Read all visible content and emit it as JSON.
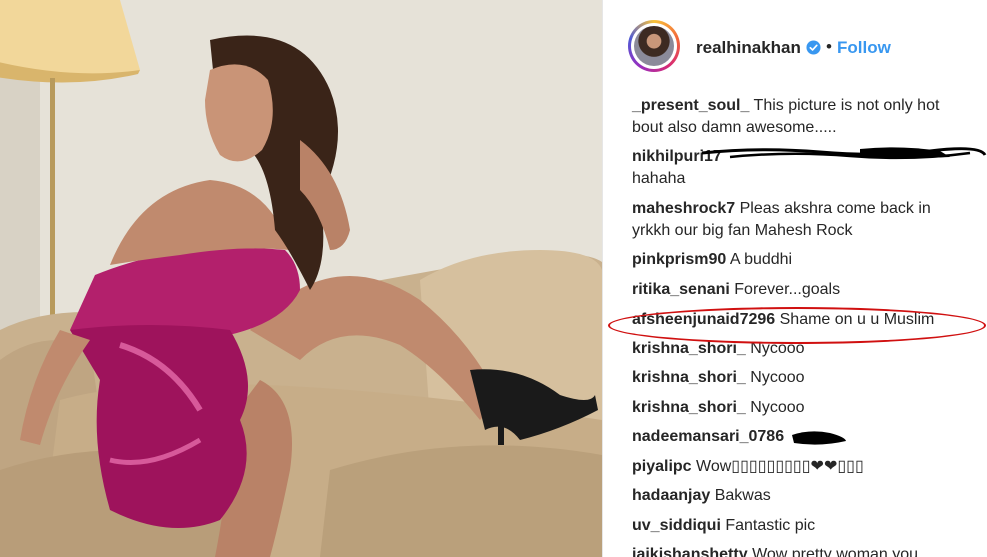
{
  "post": {
    "username": "realhinakhan",
    "follow_label": "Follow",
    "separator": "•"
  },
  "comments": [
    {
      "user": "_present_soul_",
      "text": "This picture is not only hot bout also damn awesome....."
    },
    {
      "user": "nikhilpuri17",
      "text": "hahaha"
    },
    {
      "user": "maheshrock7",
      "text": "Pleas akshra come back in yrkkh our big fan Mahesh Rock"
    },
    {
      "user": "pinkprism90",
      "text": "A buddhi"
    },
    {
      "user": "ritika_senani",
      "text": "Forever...goals"
    },
    {
      "user": "afsheenjunaid7296",
      "text": "Shame on u u Muslim"
    },
    {
      "user": "krishna_shori_",
      "text": "Nycooo"
    },
    {
      "user": "krishna_shori_",
      "text": "Nycooo"
    },
    {
      "user": "krishna_shori_",
      "text": "Nycooo"
    },
    {
      "user": "nadeemansari_0786",
      "text": ""
    },
    {
      "user": "piyalipc",
      "text": "Wow▯▯▯▯▯▯▯▯▯❤❤▯▯▯"
    },
    {
      "user": "hadaanjay",
      "text": "Bakwas"
    },
    {
      "user": "uv_siddiqui",
      "text": "Fantastic pic"
    },
    {
      "user": "jaikishanshetty",
      "text": "Wow pretty woman you"
    }
  ],
  "colors": {
    "link": "#3897f0",
    "text": "#262626",
    "annotation": "#d01010",
    "dress": "#a0155e"
  },
  "icons": {
    "verified": "verified-badge-icon"
  }
}
